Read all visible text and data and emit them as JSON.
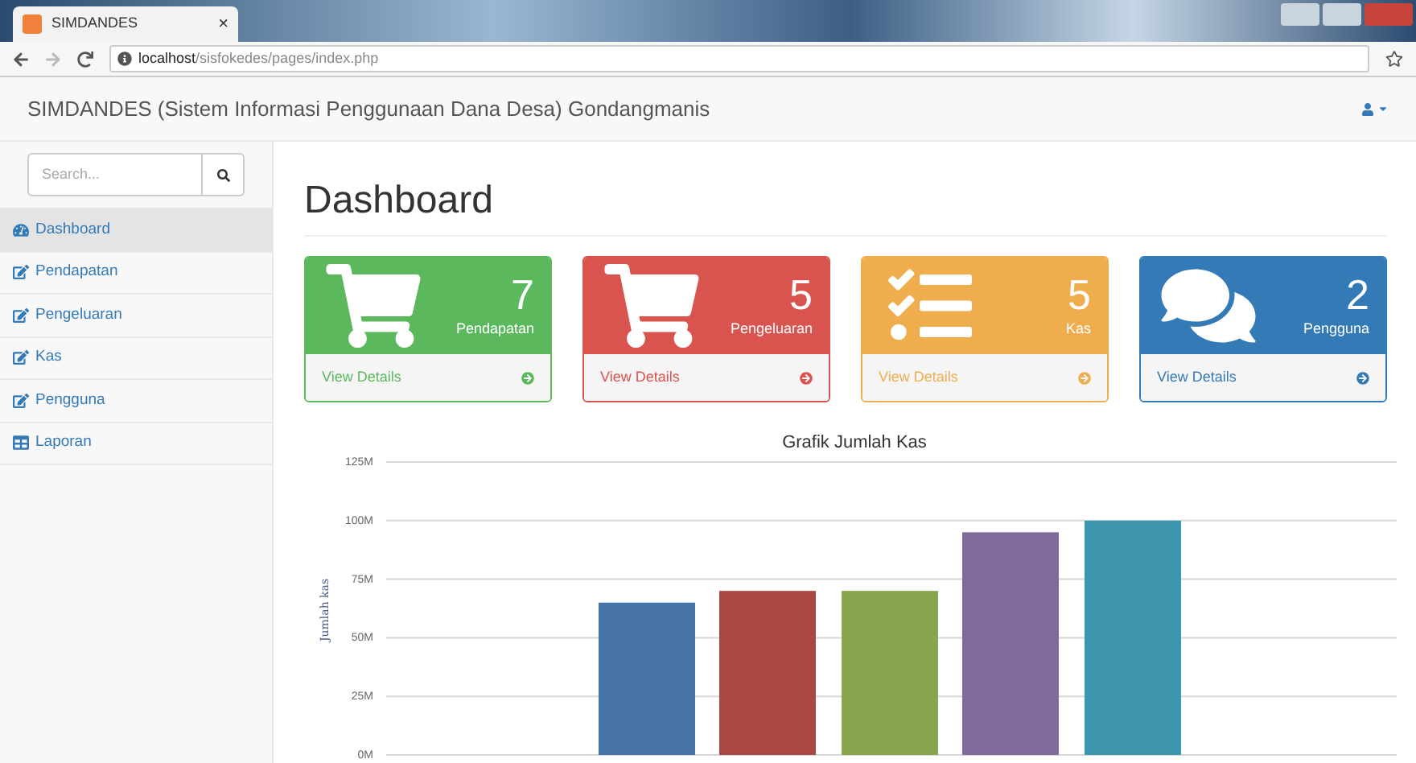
{
  "browser": {
    "tab_title": "SIMDANDES",
    "tab_close": "×",
    "url_host": "localhost",
    "url_path": "/sisfokedes/pages/index.php"
  },
  "navbar": {
    "brand": "SIMDANDES (Sistem Informasi Penggunaan Dana Desa) Gondangmanis"
  },
  "sidebar": {
    "search": {
      "placeholder": "Search..."
    },
    "items": [
      {
        "label": "Dashboard",
        "kind": "dashboard",
        "selected": true
      },
      {
        "label": "Pendapatan",
        "kind": "edit",
        "selected": false
      },
      {
        "label": "Pengeluaran",
        "kind": "edit",
        "selected": false
      },
      {
        "label": "Kas",
        "kind": "edit",
        "selected": false
      },
      {
        "label": "Pengguna",
        "kind": "edit",
        "selected": false
      },
      {
        "label": "Laporan",
        "kind": "table",
        "selected": false
      }
    ]
  },
  "page_title": "Dashboard",
  "cards": [
    {
      "kind": "cart",
      "color": "#5cb85c",
      "count": "7",
      "label": "Pendapatan",
      "link": "View Details"
    },
    {
      "kind": "cart",
      "color": "#d9534f",
      "count": "5",
      "label": "Pengeluaran",
      "link": "View Details"
    },
    {
      "kind": "tasks",
      "color": "#f0ad4e",
      "count": "5",
      "label": "Kas",
      "link": "View Details"
    },
    {
      "kind": "comments",
      "color": "#337ab7",
      "count": "2",
      "label": "Pengguna",
      "link": "View Details"
    }
  ],
  "chart_data": {
    "type": "bar",
    "grid": true,
    "title": "Grafik Jumlah Kas",
    "ylabel": "Jumlah kas",
    "ylim": [
      0,
      125000000
    ],
    "yticks": [
      {
        "value": 0,
        "label": "0M"
      },
      {
        "value": 25000000,
        "label": "25M"
      },
      {
        "value": 50000000,
        "label": "50M"
      },
      {
        "value": 75000000,
        "label": "75M"
      },
      {
        "value": 100000000,
        "label": "100M"
      },
      {
        "value": 125000000,
        "label": "125M"
      }
    ],
    "series": [
      {
        "color": "#4572a7",
        "values": [
          65000000
        ]
      },
      {
        "color": "#aa4643",
        "values": [
          70000000
        ]
      },
      {
        "color": "#89a54e",
        "values": [
          70000000
        ]
      },
      {
        "color": "#80699b",
        "values": [
          95000000
        ]
      },
      {
        "color": "#3d96ae",
        "values": [
          100000000
        ]
      }
    ]
  }
}
